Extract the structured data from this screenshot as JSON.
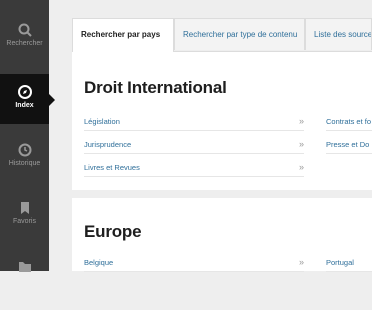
{
  "sidebar": {
    "items": [
      {
        "label": "Rechercher",
        "icon": "search-icon"
      },
      {
        "label": "Index",
        "icon": "compass-icon"
      },
      {
        "label": "Historique",
        "icon": "history-icon"
      },
      {
        "label": "Favoris",
        "icon": "bookmark-icon"
      },
      {
        "label": "",
        "icon": "folder-icon"
      }
    ],
    "active": "Index"
  },
  "tabs": [
    {
      "label": "Rechercher par pays"
    },
    {
      "label": "Rechercher par type de contenu"
    },
    {
      "label": "Liste des sources"
    }
  ],
  "sections": [
    {
      "title": "Droit International",
      "left_links": [
        "Législation",
        "Jurisprudence",
        "Livres et Revues"
      ],
      "right_links": [
        "Contrats et fo",
        "Presse et Do"
      ]
    },
    {
      "title": "Europe",
      "left_links": [
        "Belgique"
      ],
      "right_links": [
        "Portugal"
      ]
    }
  ],
  "arrow_glyph": "»",
  "colors": {
    "sidebar_bg": "#3a3a3a",
    "sidebar_active": "#111111",
    "link": "#2f6f9a",
    "page_bg": "#eeeeee"
  }
}
